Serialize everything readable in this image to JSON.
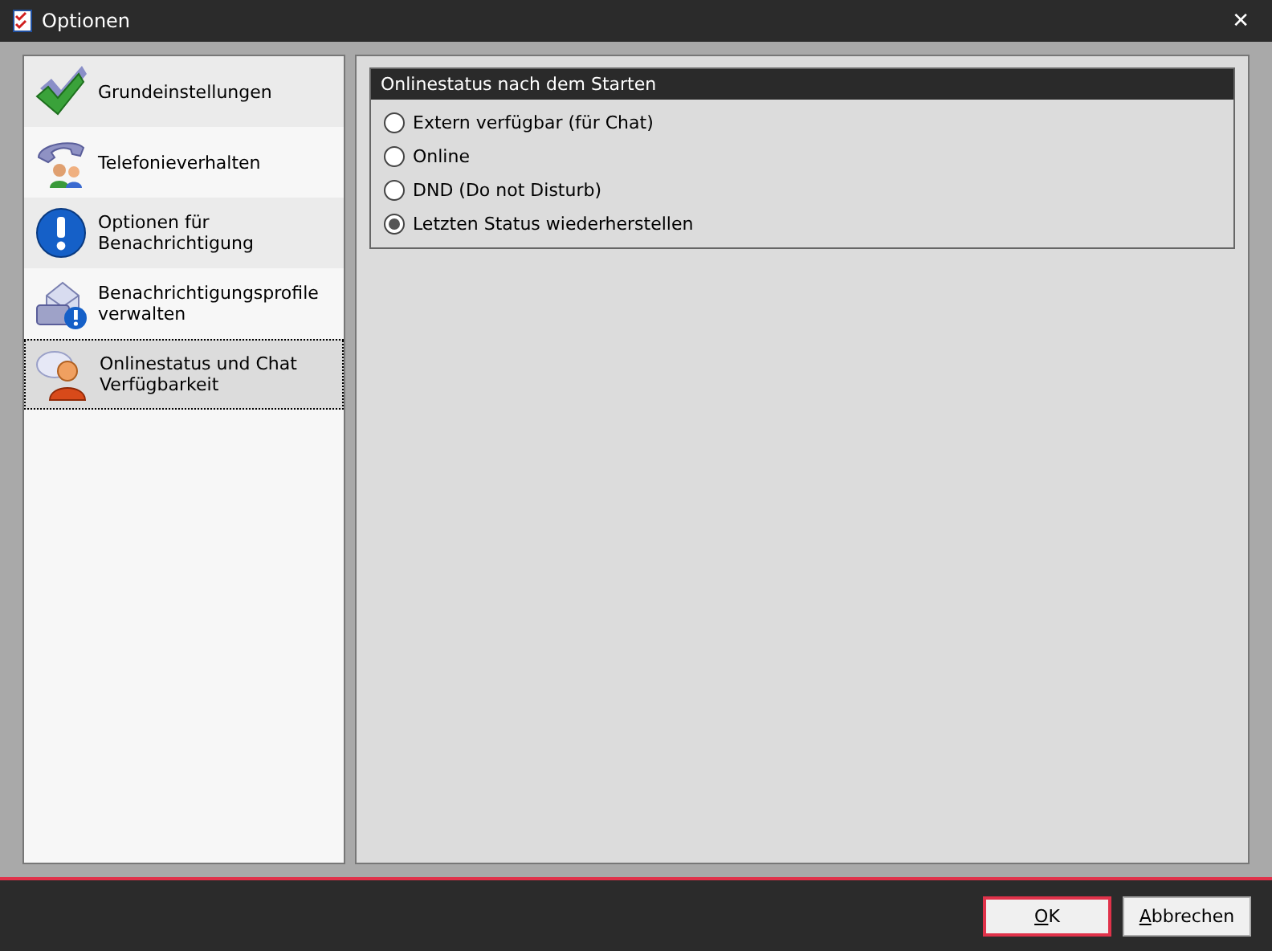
{
  "window": {
    "title": "Optionen",
    "close": "✕"
  },
  "sidebar": {
    "items": [
      {
        "label": "Grundeinstellungen",
        "selected": false
      },
      {
        "label": "Telefonieverhalten",
        "selected": false
      },
      {
        "label": "Optionen für Benachrichtigung",
        "selected": false
      },
      {
        "label": "Benachrichtigungsprofile verwalten",
        "selected": false
      },
      {
        "label": "Onlinestatus und Chat Verfügbarkeit",
        "selected": true
      }
    ]
  },
  "group": {
    "title": "Onlinestatus nach dem Starten",
    "options": [
      {
        "label": "Extern verfügbar (für Chat)",
        "selected": false
      },
      {
        "label": "Online",
        "selected": false
      },
      {
        "label": "DND (Do not Disturb)",
        "selected": false
      },
      {
        "label": "Letzten Status wiederherstellen",
        "selected": true
      }
    ]
  },
  "buttons": [
    {
      "label": "OK",
      "default": true
    },
    {
      "label": "Abbrechen",
      "default": false
    }
  ]
}
